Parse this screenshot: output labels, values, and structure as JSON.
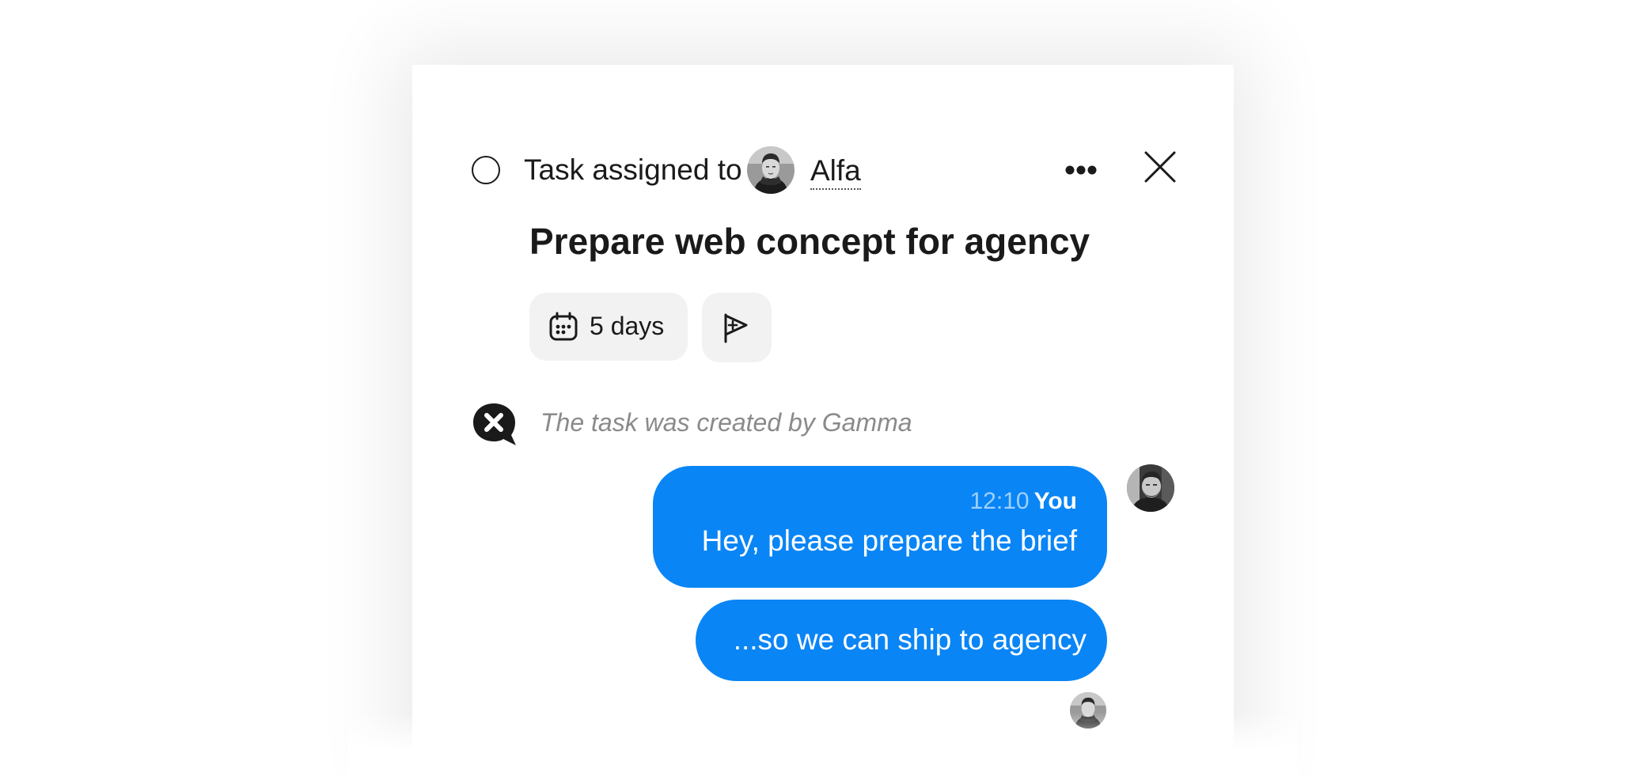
{
  "task": {
    "assigned_label": "Task assigned to",
    "assignee": "Alfa",
    "title": "Prepare web concept for agency",
    "due_label": "5 days"
  },
  "activity": {
    "created_text": "The task was created by Gamma"
  },
  "messages": [
    {
      "time": "12:10",
      "author": "You",
      "text": "Hey, please prepare the brief"
    },
    {
      "text": "...so we can ship to agency"
    }
  ],
  "colors": {
    "bubble": "#0a85f5",
    "text_dark": "#1a1a1a",
    "chip_bg": "#f2f2f2",
    "muted": "#8a8a8a"
  },
  "icons": [
    "status-circle-icon",
    "more-icon",
    "close-icon",
    "calendar-icon",
    "flag-plus-icon",
    "activity-icon"
  ]
}
